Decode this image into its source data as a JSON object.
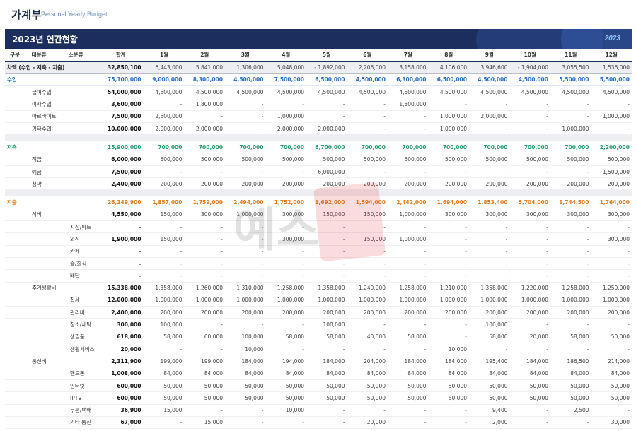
{
  "header": {
    "title": "가계부",
    "subtitle": "Personal Yearly Budget"
  },
  "banner": {
    "title": "2023년 연간현황",
    "year": "2023"
  },
  "columns": {
    "major": "구분",
    "mid": "대분류",
    "minor": "소분류",
    "total": "합계",
    "months": [
      "1월",
      "2월",
      "3월",
      "4월",
      "5월",
      "6월",
      "7월",
      "8월",
      "9월",
      "10월",
      "11월",
      "12월"
    ]
  },
  "rows": [
    {
      "type": "net",
      "label": "차액 (수입 - 저축 - 지출)",
      "level": 0,
      "total": "32,850,100",
      "months": [
        "6,443,000",
        "5,841,000",
        "1,306,000",
        "5,048,000",
        "- 1,892,000",
        "2,206,000",
        "3,158,000",
        "4,106,000",
        "3,946,600",
        "- 1,904,000",
        "3,055,500",
        "1,536,000"
      ]
    },
    {
      "type": "sec-income",
      "label": "수입",
      "level": 0,
      "total": "75,100,000",
      "months": [
        "9,000,000",
        "8,300,000",
        "4,500,000",
        "7,500,000",
        "6,500,000",
        "4,500,000",
        "6,300,000",
        "6,500,000",
        "4,500,000",
        "4,500,000",
        "5,500,000",
        "5,500,000"
      ]
    },
    {
      "type": "row",
      "label": "급여수입",
      "level": 1,
      "total": "54,000,000",
      "months": [
        "4,500,000",
        "4,500,000",
        "4,500,000",
        "4,500,000",
        "4,500,000",
        "4,500,000",
        "4,500,000",
        "4,500,000",
        "4,500,000",
        "4,500,000",
        "4,500,000",
        "4,500,000"
      ]
    },
    {
      "type": "row",
      "label": "이자수입",
      "level": 1,
      "total": "3,600,000",
      "months": [
        "-",
        "1,800,000",
        "-",
        "-",
        "-",
        "-",
        "1,800,000",
        "-",
        "-",
        "-",
        "-",
        "-"
      ]
    },
    {
      "type": "row",
      "label": "아르바이트",
      "level": 1,
      "total": "7,500,000",
      "months": [
        "2,500,000",
        "-",
        "-",
        "1,000,000",
        "-",
        "-",
        "-",
        "1,000,000",
        "2,000,000",
        "-",
        "-",
        "1,000,000"
      ]
    },
    {
      "type": "row",
      "label": "기타수입",
      "level": 1,
      "total": "10,000,000",
      "months": [
        "2,000,000",
        "2,000,000",
        "-",
        "2,000,000",
        "2,000,000",
        "-",
        "-",
        "1,000,000",
        "-",
        "-",
        "1,000,000",
        "-"
      ]
    },
    {
      "type": "gap"
    },
    {
      "type": "sec-saving",
      "label": "저축",
      "level": 0,
      "total": "15,900,000",
      "months": [
        "700,000",
        "700,000",
        "700,000",
        "700,000",
        "6,700,000",
        "700,000",
        "700,000",
        "700,000",
        "700,000",
        "700,000",
        "700,000",
        "2,200,000"
      ]
    },
    {
      "type": "row",
      "label": "적금",
      "level": 1,
      "total": "6,000,000",
      "months": [
        "500,000",
        "500,000",
        "500,000",
        "500,000",
        "500,000",
        "500,000",
        "500,000",
        "500,000",
        "500,000",
        "500,000",
        "500,000",
        "500,000"
      ]
    },
    {
      "type": "row",
      "label": "예금",
      "level": 1,
      "total": "7,500,000",
      "months": [
        "-",
        "-",
        "-",
        "-",
        "6,000,000",
        "-",
        "-",
        "-",
        "-",
        "-",
        "-",
        "1,500,000"
      ]
    },
    {
      "type": "row",
      "label": "청약",
      "level": 1,
      "total": "2,400,000",
      "months": [
        "200,000",
        "200,000",
        "200,000",
        "200,000",
        "200,000",
        "200,000",
        "200,000",
        "200,000",
        "200,000",
        "200,000",
        "200,000",
        "200,000"
      ]
    },
    {
      "type": "gap"
    },
    {
      "type": "sec-expense",
      "label": "지출",
      "level": 0,
      "total": "26,349,900",
      "months": [
        "1,857,000",
        "1,759,000",
        "2,494,000",
        "1,752,000",
        "1,692,000",
        "1,594,000",
        "2,442,000",
        "1,694,000",
        "1,853,400",
        "5,704,000",
        "1,744,500",
        "1,764,000"
      ]
    },
    {
      "type": "row",
      "label": "식비",
      "level": 1,
      "total": "4,550,000",
      "months": [
        "150,000",
        "300,000",
        "1,000,000",
        "300,000",
        "150,000",
        "150,000",
        "1,000,000",
        "300,000",
        "300,000",
        "300,000",
        "300,000",
        "300,000"
      ]
    },
    {
      "type": "row",
      "label": "시장/마트",
      "level": 2,
      "total": "-",
      "months": [
        "-",
        "-",
        "-",
        "-",
        "-",
        "-",
        "-",
        "-",
        "-",
        "-",
        "-",
        "-"
      ]
    },
    {
      "type": "row",
      "label": "외식",
      "level": 2,
      "total": "1,900,000",
      "months": [
        "150,000",
        "-",
        "-",
        "300,000",
        "-",
        "150,000",
        "1,000,000",
        "-",
        "-",
        "-",
        "-",
        "300,000"
      ]
    },
    {
      "type": "row",
      "label": "카페",
      "level": 2,
      "total": "-",
      "months": [
        "-",
        "-",
        "-",
        "-",
        "-",
        "-",
        "-",
        "-",
        "-",
        "-",
        "-",
        "-"
      ]
    },
    {
      "type": "row",
      "label": "술/회식",
      "level": 2,
      "total": "-",
      "months": [
        "-",
        "-",
        "-",
        "-",
        "-",
        "-",
        "-",
        "-",
        "-",
        "-",
        "-",
        "-"
      ]
    },
    {
      "type": "row",
      "label": "배달",
      "level": 2,
      "total": "-",
      "months": [
        "-",
        "-",
        "-",
        "-",
        "-",
        "-",
        "-",
        "-",
        "-",
        "-",
        "-",
        "-"
      ]
    },
    {
      "type": "cat",
      "label": "주거생활비",
      "level": 1,
      "total": "15,338,000",
      "months": [
        "1,358,000",
        "1,260,000",
        "1,310,000",
        "1,258,000",
        "1,358,000",
        "1,240,000",
        "1,258,000",
        "1,210,000",
        "1,358,000",
        "1,220,000",
        "1,258,000",
        "1,250,000"
      ]
    },
    {
      "type": "row",
      "label": "집세",
      "level": 2,
      "total": "12,000,000",
      "months": [
        "1,000,000",
        "1,000,000",
        "1,000,000",
        "1,000,000",
        "1,000,000",
        "1,000,000",
        "1,000,000",
        "1,000,000",
        "1,000,000",
        "1,000,000",
        "1,000,000",
        "1,000,000"
      ]
    },
    {
      "type": "row",
      "label": "관리비",
      "level": 2,
      "total": "2,400,000",
      "months": [
        "200,000",
        "200,000",
        "200,000",
        "200,000",
        "200,000",
        "200,000",
        "200,000",
        "200,000",
        "200,000",
        "200,000",
        "200,000",
        "200,000"
      ]
    },
    {
      "type": "row",
      "label": "청소/세탁",
      "level": 2,
      "total": "300,000",
      "months": [
        "100,000",
        "-",
        "-",
        "-",
        "100,000",
        "-",
        "-",
        "-",
        "100,000",
        "-",
        "-",
        "-"
      ]
    },
    {
      "type": "row",
      "label": "생필품",
      "level": 2,
      "total": "618,000",
      "months": [
        "58,000",
        "60,000",
        "100,000",
        "58,000",
        "58,000",
        "40,000",
        "58,000",
        "-",
        "58,000",
        "20,000",
        "58,000",
        "50,000"
      ]
    },
    {
      "type": "row",
      "label": "생활서비스",
      "level": 2,
      "total": "20,000",
      "months": [
        "-",
        "-",
        "10,000",
        "-",
        "-",
        "-",
        "-",
        "10,000",
        "-",
        "-",
        "-",
        "-"
      ]
    },
    {
      "type": "cat",
      "label": "통신비",
      "level": 1,
      "total": "2,311,900",
      "months": [
        "199,000",
        "199,000",
        "184,000",
        "194,000",
        "184,000",
        "204,000",
        "184,000",
        "184,000",
        "195,400",
        "184,000",
        "186,500",
        "214,000"
      ]
    },
    {
      "type": "row",
      "label": "핸드폰",
      "level": 2,
      "total": "1,008,000",
      "months": [
        "84,000",
        "84,000",
        "84,000",
        "84,000",
        "84,000",
        "84,000",
        "84,000",
        "84,000",
        "84,000",
        "84,000",
        "84,000",
        "84,000"
      ]
    },
    {
      "type": "row",
      "label": "인터넷",
      "level": 2,
      "total": "600,000",
      "months": [
        "50,000",
        "50,000",
        "50,000",
        "50,000",
        "50,000",
        "50,000",
        "50,000",
        "50,000",
        "50,000",
        "50,000",
        "50,000",
        "50,000"
      ]
    },
    {
      "type": "row",
      "label": "IPTV",
      "level": 2,
      "total": "600,000",
      "months": [
        "50,000",
        "50,000",
        "50,000",
        "50,000",
        "50,000",
        "50,000",
        "50,000",
        "50,000",
        "50,000",
        "50,000",
        "50,000",
        "50,000"
      ]
    },
    {
      "type": "row",
      "label": "우편/택배",
      "level": 2,
      "total": "36,900",
      "months": [
        "15,000",
        "-",
        "-",
        "10,000",
        "-",
        "-",
        "-",
        "-",
        "9,400",
        "-",
        "2,500",
        "-"
      ]
    },
    {
      "type": "row",
      "label": "기타 통신",
      "level": 2,
      "total": "67,000",
      "months": [
        "-",
        "15,000",
        "-",
        "-",
        "-",
        "20,000",
        "-",
        "-",
        "2,000",
        "-",
        "-",
        "30,000"
      ]
    }
  ],
  "watermark": {
    "text": "예스"
  },
  "colors": {
    "banner": "#1c2e5e",
    "income": "#2a6fc4",
    "saving": "#1f9a6a",
    "expense": "#e07a1c"
  }
}
